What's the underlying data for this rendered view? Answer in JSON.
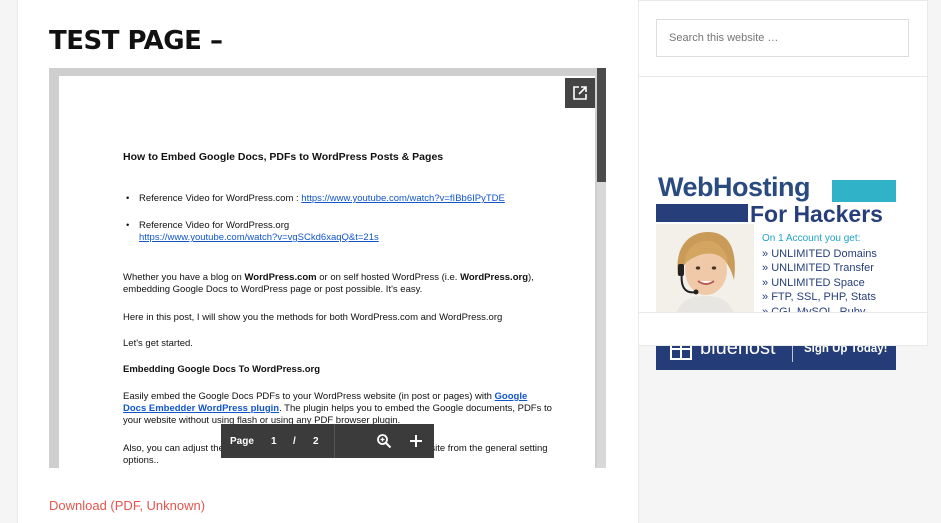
{
  "page": {
    "title": "TEST PAGE –"
  },
  "viewer": {
    "document": {
      "heading": "How to Embed Google Docs, PDFs to WordPress Posts & Pages",
      "bullet1_text": "Reference Video for WordPress.com : ",
      "bullet1_link": "https://www.youtube.com/watch?v=fIBb6IPyTDE",
      "bullet2_text": "Reference Video for WordPress.org",
      "bullet2_link": "https://www.youtube.com/watch?v=vgSCkd6xaqQ&t=21s",
      "para1_a": "Whether you have a blog on ",
      "para1_b": "WordPress.com",
      "para1_c": " or on self hosted WordPress (i.e. ",
      "para1_d": "WordPress.org",
      "para1_e": "), embedding Google Docs to WordPress page or post possible. It's easy.",
      "para2": "Here in this post, I will show you the methods for both WordPress.com and WordPress.org",
      "para3": "Let's get started.",
      "section_heading": "Embedding Google Docs To WordPress.org",
      "para4_a": "Easily embed the Google Docs PDFs to your WordPress website (in post or pages) with ",
      "para4_link": "Google Docs Embedder WordPress plugin",
      "para4_b": ". The plugin helps you to embed the Google documents, PDFs to your website without using flash or using any PDF browser plugin.",
      "para5": "Also, you can adjust the height and width of the PDFs embedded to your site from the general setting options.."
    },
    "toolbar": {
      "page_label": "Page",
      "current_page": "1",
      "separator": "/",
      "total_pages": "2",
      "zoom_icon": "zoom-in-icon",
      "plus_icon": "plus-icon"
    },
    "popout_icon": "open-in-new-icon"
  },
  "download_link": "Download (PDF, Unknown)",
  "sidebar": {
    "search_placeholder": "Search this website …",
    "ad": {
      "title_line1": "WebHosting",
      "title_line2": "For Hackers",
      "subtitle": "On 1 Account you get:",
      "features": [
        "UNLIMITED Domains",
        "UNLIMITED Transfer",
        "UNLIMITED Space",
        "FTP, SSL, PHP, Stats",
        "CGI, MySQL, Ruby"
      ],
      "brand": "bluehost",
      "cta": "Sign Up Today!",
      "colors": {
        "navy": "#243c78",
        "teal": "#30b2c9"
      }
    }
  },
  "colors": {
    "link": "#e5554e",
    "doc_link": "#1155cc"
  }
}
